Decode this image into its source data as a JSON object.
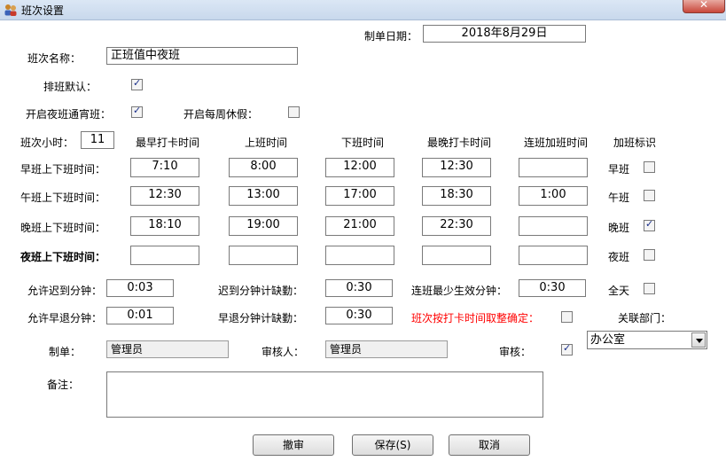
{
  "window": {
    "title": "班次设置",
    "close_symbol": "✕"
  },
  "form": {
    "date_label": "制单日期：",
    "date_value": "2018年8月29日",
    "shift_name_label": "班次名称：",
    "shift_name_value": "正班值中夜班",
    "default_label": "排班默认：",
    "default_checked": true,
    "night_label": "开启夜班通宵班：",
    "night_checked": true,
    "weekly_label": "开启每周休假：",
    "weekly_checked": false,
    "hours_label": "班次小时：",
    "hours_value": "11",
    "columns": [
      "最早打卡时间",
      "上班时间",
      "下班时间",
      "最晚打卡时间",
      "连班加班时间",
      "加班标识"
    ],
    "rows": [
      {
        "label": "早班上下班时间：",
        "bold": false,
        "values": [
          "7:10",
          "8:00",
          "12:00",
          "12:30",
          ""
        ],
        "flag_label": "早班",
        "flag_checked": false
      },
      {
        "label": "午班上下班时间：",
        "bold": false,
        "values": [
          "12:30",
          "13:00",
          "17:00",
          "18:30",
          "1:00"
        ],
        "flag_label": "午班",
        "flag_checked": false
      },
      {
        "label": "晚班上下班时间：",
        "bold": false,
        "values": [
          "18:10",
          "19:00",
          "21:00",
          "22:30",
          ""
        ],
        "flag_label": "晚班",
        "flag_checked": true
      },
      {
        "label": "夜班上下班时间：",
        "bold": true,
        "values": [
          "",
          "",
          "",
          "",
          ""
        ],
        "flag_label": "夜班",
        "flag_checked": false
      }
    ],
    "late_allow_label": "允许迟到分钟：",
    "late_allow_value": "0:03",
    "late_absent_label": "迟到分钟计缺勤：",
    "late_absent_value": "0:30",
    "min_continuous_label": "连班最少生效分钟：",
    "min_continuous_value": "0:30",
    "fullday_label": "全天",
    "fullday_checked": false,
    "early_allow_label": "允许早退分钟：",
    "early_allow_value": "0:01",
    "early_absent_label": "早退分钟计缺勤：",
    "early_absent_value": "0:30",
    "round_label": "班次按打卡时间取整确定：",
    "round_checked": false,
    "dept_label": "关联部门：",
    "dept_value": "办公室",
    "maker_label": "制单：",
    "maker_value": "管理员",
    "reviewer_label": "审核人：",
    "reviewer_value": "管理员",
    "audit_label": "审核：",
    "audit_checked": true,
    "remark_label": "备注：",
    "remark_value": ""
  },
  "buttons": {
    "unaudit": "撤审",
    "save": "保存(S)",
    "cancel": "取消"
  },
  "colors": {
    "warning_text": "#ff0000",
    "check_mark": "#1a2f8a"
  }
}
